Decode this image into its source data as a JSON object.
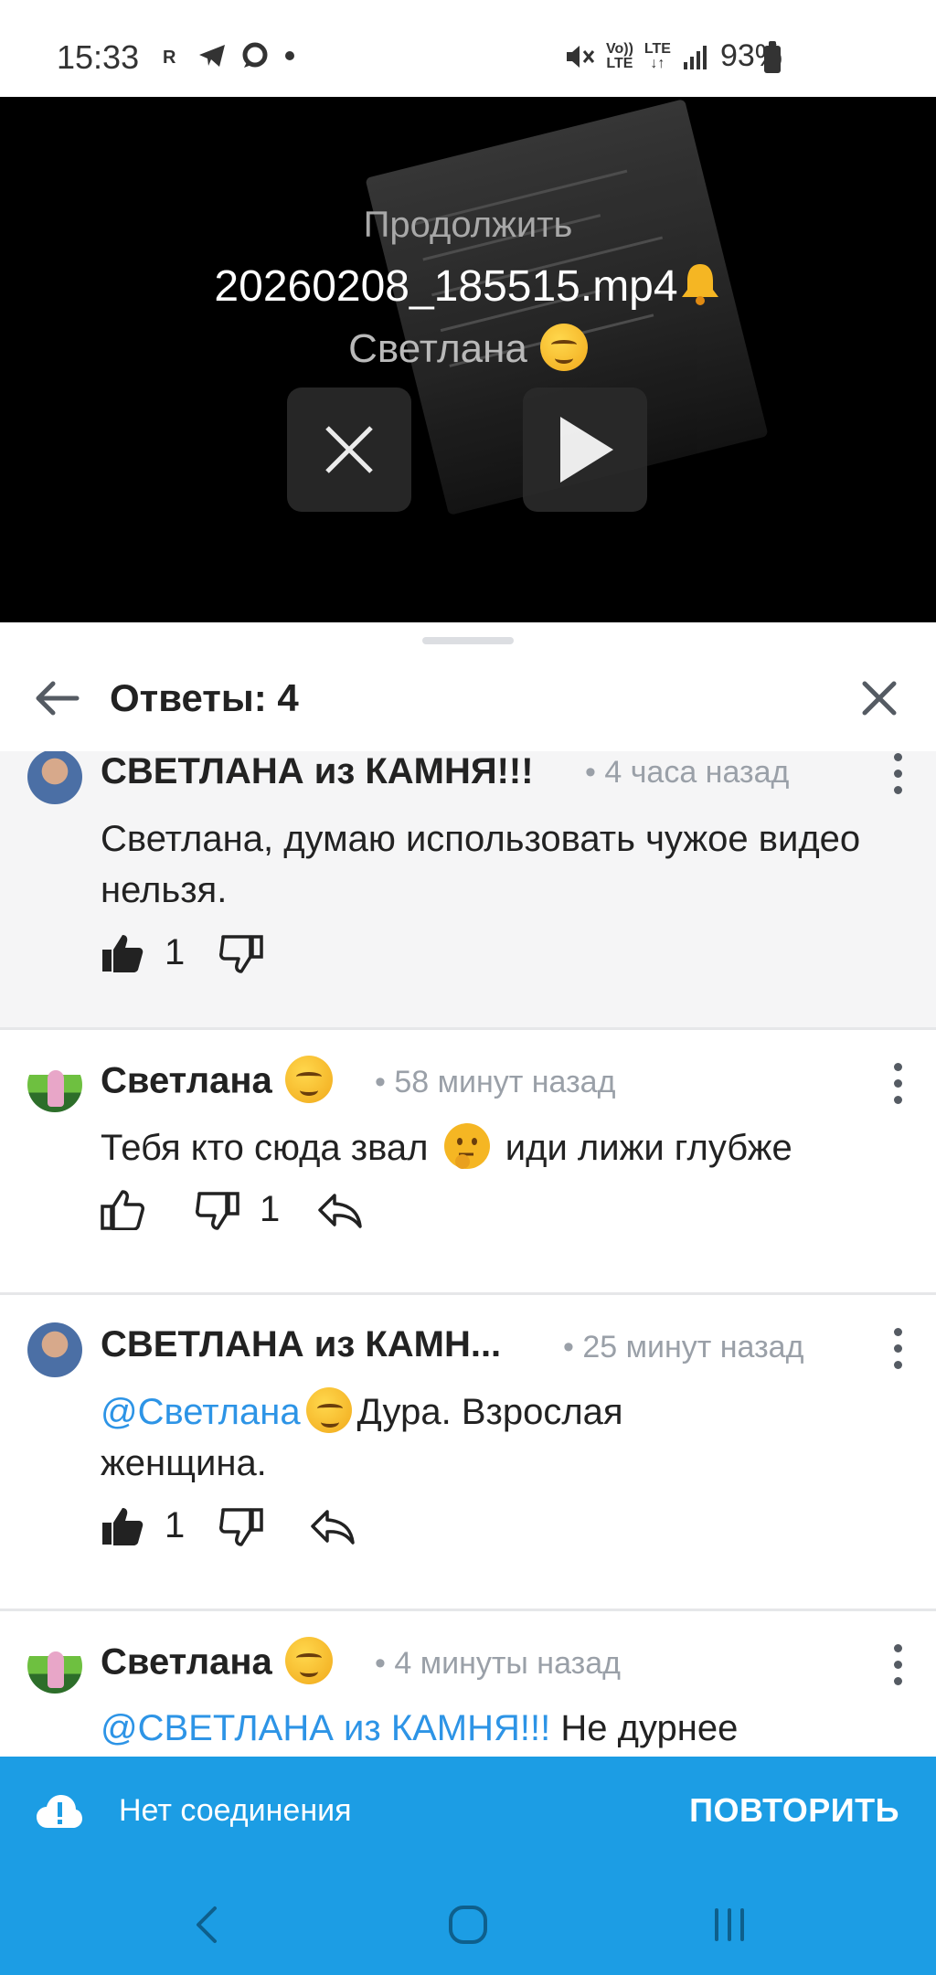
{
  "status_bar": {
    "time": "15:33",
    "left_icons": [
      "r-icon",
      "telegram-icon",
      "message-icon",
      "dot-icon"
    ],
    "volte_top": "Vo))",
    "volte_bottom": "LTE",
    "lte_label": "LTE",
    "battery": "93%"
  },
  "video": {
    "continue_label": "Продолжить",
    "filename": "20260208_185515.mp4",
    "author": "Светлана"
  },
  "sheet": {
    "title": "Ответы: 4"
  },
  "comments": [
    {
      "author": "СВЕТЛАНА из КАМНЯ!!!",
      "time": "• 4 часа назад",
      "text": "Светлана, думаю использовать чужое видео нельзя.",
      "likes": "1",
      "dislikes": "",
      "liked": true
    },
    {
      "author": "Светлана",
      "time": "• 58 минут назад",
      "text_before": "Тебя кто сюда звал",
      "text_after": "иди лижи глубже",
      "likes": "",
      "dislikes": "1",
      "liked": false
    },
    {
      "author": "СВЕТЛАНА из КАМН...",
      "time": "• 25 минут назад",
      "mention": "@Светлана",
      "text": "Дура. Взрослая женщина.",
      "likes": "1",
      "dislikes": "",
      "liked": true
    },
    {
      "author": "Светлана",
      "time": "• 4 минуты назад",
      "mention": "@СВЕТЛАНА из КАМНЯ!!!",
      "text": "Не дурнее"
    }
  ],
  "connection": {
    "message": "Нет соединения",
    "retry": "ПОВТОРИТЬ"
  },
  "colors": {
    "accent": "#1c9de4",
    "mention": "#2d94e6",
    "muted": "#9aa0a8"
  }
}
